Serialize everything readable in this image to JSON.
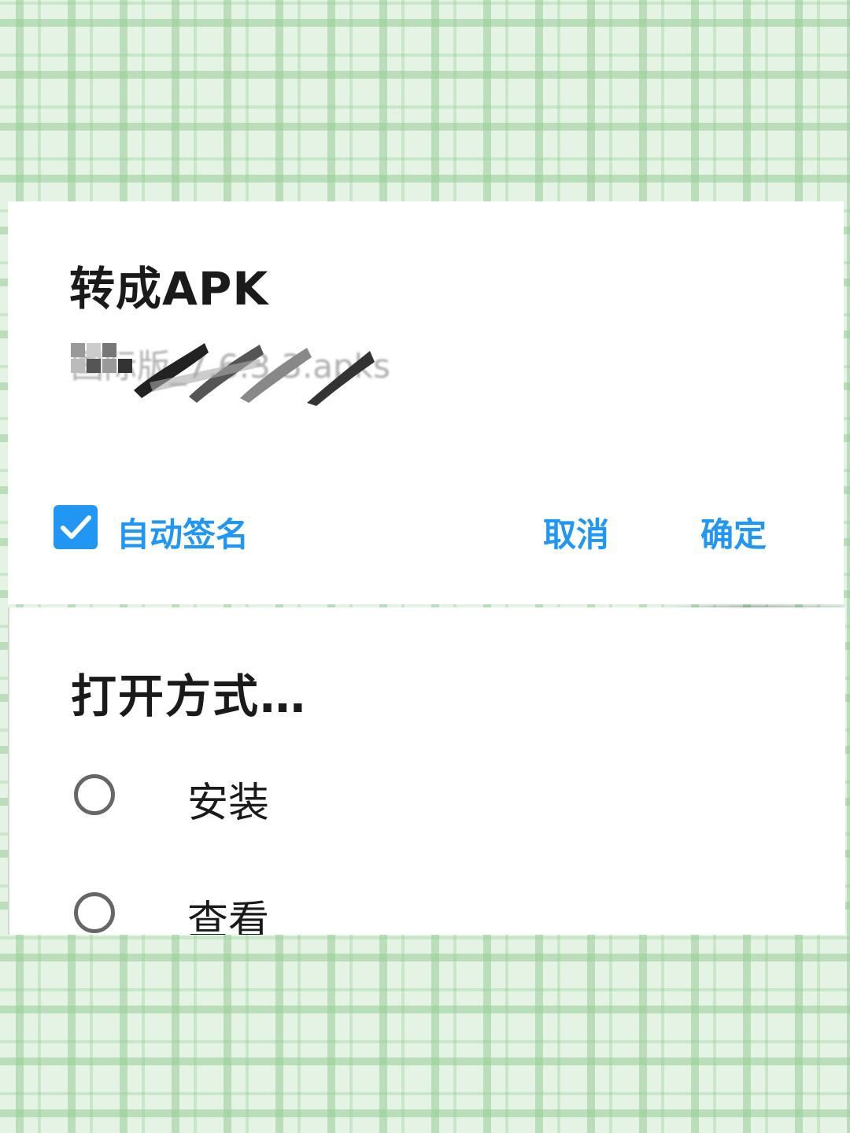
{
  "convert_dialog": {
    "title": "转成APK",
    "filename_visible": "国际版_7.6.3.3.apks",
    "auto_sign": {
      "label": "自动签名",
      "checked": true
    },
    "cancel_label": "取消",
    "ok_label": "确定"
  },
  "open_with_dialog": {
    "title": "打开方式…",
    "options": [
      {
        "label": "安装",
        "selected": false
      },
      {
        "label": "查看",
        "selected": false
      }
    ]
  },
  "colors": {
    "accent": "#2196f3",
    "text": "#1a1a1a",
    "radio": "#666666",
    "background_plaid": "#e4f3e4"
  },
  "icons": {
    "checkbox": "checkmark-icon"
  }
}
